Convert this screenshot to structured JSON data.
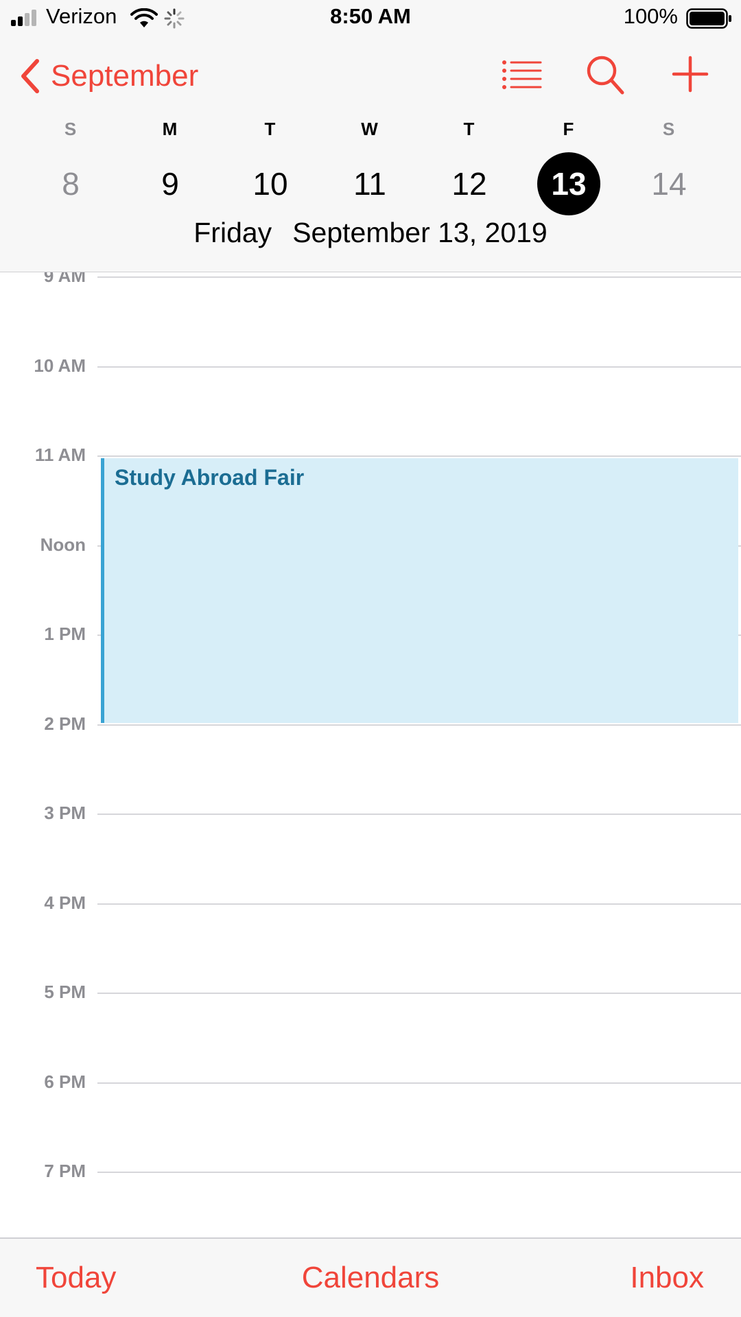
{
  "status_bar": {
    "carrier": "Verizon",
    "time": "8:50 AM",
    "battery_percent": "100%",
    "signal_bars": 2,
    "signal_bars_total": 4,
    "battery_level": 1.0,
    "icons": [
      "signal-icon",
      "wifi-icon",
      "activity-icon",
      "battery-icon"
    ]
  },
  "header": {
    "back_label": "September",
    "icons": [
      "chevron-left-icon",
      "list-icon",
      "search-icon",
      "plus-icon"
    ]
  },
  "week": {
    "days": [
      {
        "letter": "S",
        "number": "8",
        "weekend": true,
        "selected": false
      },
      {
        "letter": "M",
        "number": "9",
        "weekend": false,
        "selected": false
      },
      {
        "letter": "T",
        "number": "10",
        "weekend": false,
        "selected": false
      },
      {
        "letter": "W",
        "number": "11",
        "weekend": false,
        "selected": false
      },
      {
        "letter": "T",
        "number": "12",
        "weekend": false,
        "selected": false
      },
      {
        "letter": "F",
        "number": "13",
        "weekend": false,
        "selected": true
      },
      {
        "letter": "S",
        "number": "14",
        "weekend": true,
        "selected": false
      }
    ],
    "selected_weekday": "Friday",
    "selected_date": "September 13, 2019"
  },
  "timeline": {
    "hours": [
      "9 AM",
      "10 AM",
      "11 AM",
      "Noon",
      "1 PM",
      "2 PM",
      "3 PM",
      "4 PM",
      "5 PM",
      "6 PM",
      "7 PM"
    ],
    "events": [
      {
        "title": "Study Abroad Fair",
        "start_hour": "11 AM",
        "end_hour": "2 PM"
      }
    ]
  },
  "toolbar": {
    "today_label": "Today",
    "calendars_label": "Calendars",
    "inbox_label": "Inbox"
  },
  "colors": {
    "accent": "#f0453a",
    "event_fill": "#d7eef8",
    "event_bar": "#3aa3d3",
    "event_text": "#1b6d93",
    "hour_label": "#8e8e93"
  }
}
